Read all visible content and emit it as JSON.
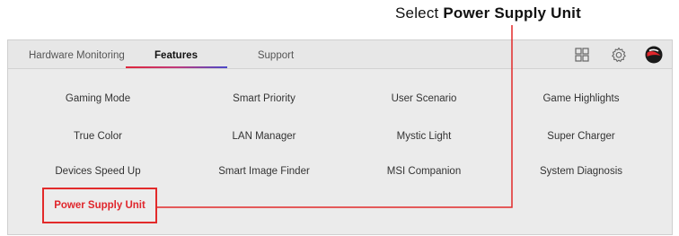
{
  "callout": {
    "prefix": "Select",
    "target": "Power Supply Unit"
  },
  "tabs": [
    {
      "label": "Hardware Monitoring",
      "active": false
    },
    {
      "label": "Features",
      "active": true
    },
    {
      "label": "Support",
      "active": false
    }
  ],
  "toolbar_icons": [
    "grid-view-icon",
    "gear-icon",
    "msi-dragon-logo-icon"
  ],
  "features": {
    "row1": [
      "Gaming Mode",
      "Smart Priority",
      "User Scenario",
      "Game Highlights"
    ],
    "row2": [
      "True Color",
      "LAN Manager",
      "Mystic Light",
      "Super Charger"
    ],
    "row3": [
      "Devices Speed Up",
      "Smart Image Finder",
      "MSI Companion",
      "System Diagnosis"
    ],
    "row4": [
      "Power Supply Unit"
    ]
  },
  "colors": {
    "highlight": "#e22a2a",
    "tab_underline_start": "#e0263a",
    "tab_underline_end": "#4a49c9",
    "panel_background": "#ebebeb"
  }
}
